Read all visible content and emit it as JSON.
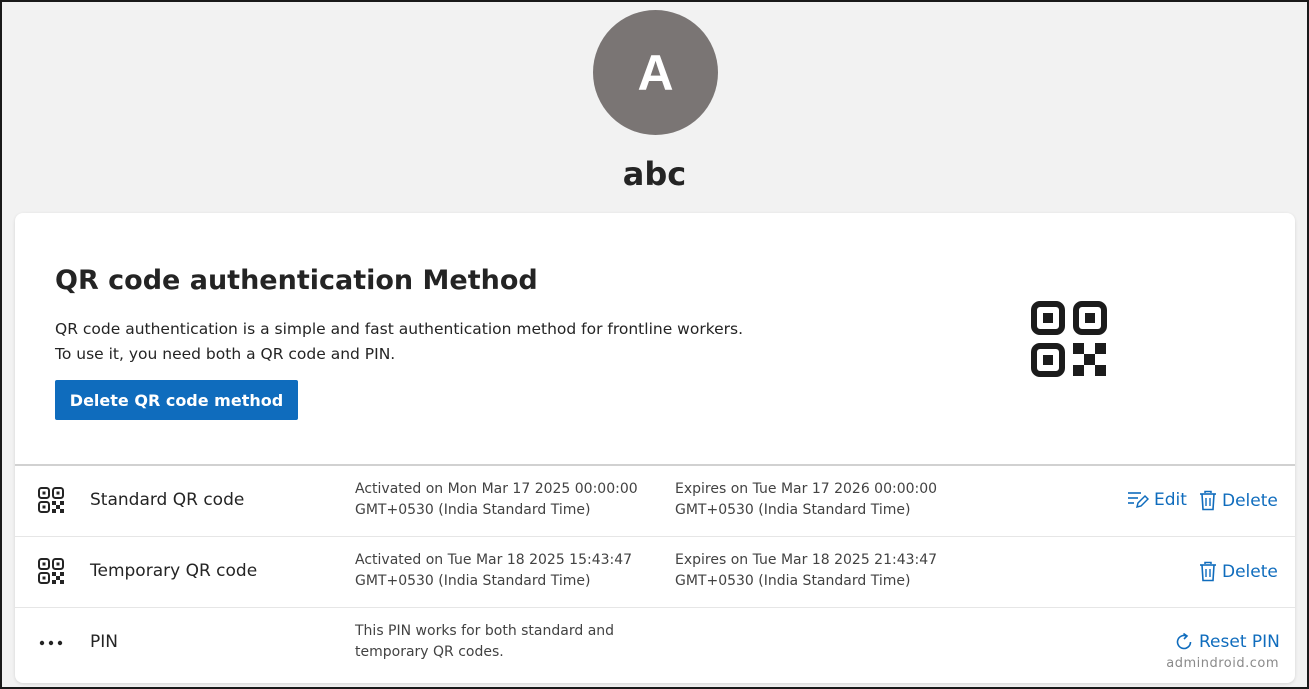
{
  "user": {
    "avatar_initial": "A",
    "name": "abc"
  },
  "method": {
    "title": "QR code authentication Method",
    "description_line1": "QR code authentication is a simple and fast authentication method for frontline workers.",
    "description_line2": "To use it, you need both a QR code and PIN.",
    "delete_button_label": "Delete QR code method",
    "icon": "qr-code-icon"
  },
  "rows": [
    {
      "label": "Standard QR code",
      "icon": "qr-code-icon",
      "activated_line1": "Activated on Mon Mar 17 2025 00:00:00",
      "activated_line2": "GMT+0530 (India Standard Time)",
      "expires_line1": "Expires on Tue Mar 17 2026 00:00:00",
      "expires_line2": "GMT+0530 (India Standard Time)",
      "edit_label": "Edit",
      "delete_label": "Delete"
    },
    {
      "label": "Temporary QR code",
      "icon": "qr-code-icon",
      "activated_line1": "Activated on Tue Mar 18 2025 15:43:47",
      "activated_line2": "GMT+0530 (India Standard Time)",
      "expires_line1": "Expires on Tue Mar 18 2025 21:43:47",
      "expires_line2": "GMT+0530 (India Standard Time)",
      "delete_label": "Delete"
    },
    {
      "label": "PIN",
      "icon": "more-dots-icon",
      "note_line1": "This PIN works for both standard and",
      "note_line2": "temporary QR codes.",
      "reset_label": "Reset PIN"
    }
  ],
  "watermark": "admindroid.com",
  "colors": {
    "accent": "#0f6cbd",
    "avatar_bg": "#7a7574",
    "page_bg": "#f2f2f2"
  }
}
